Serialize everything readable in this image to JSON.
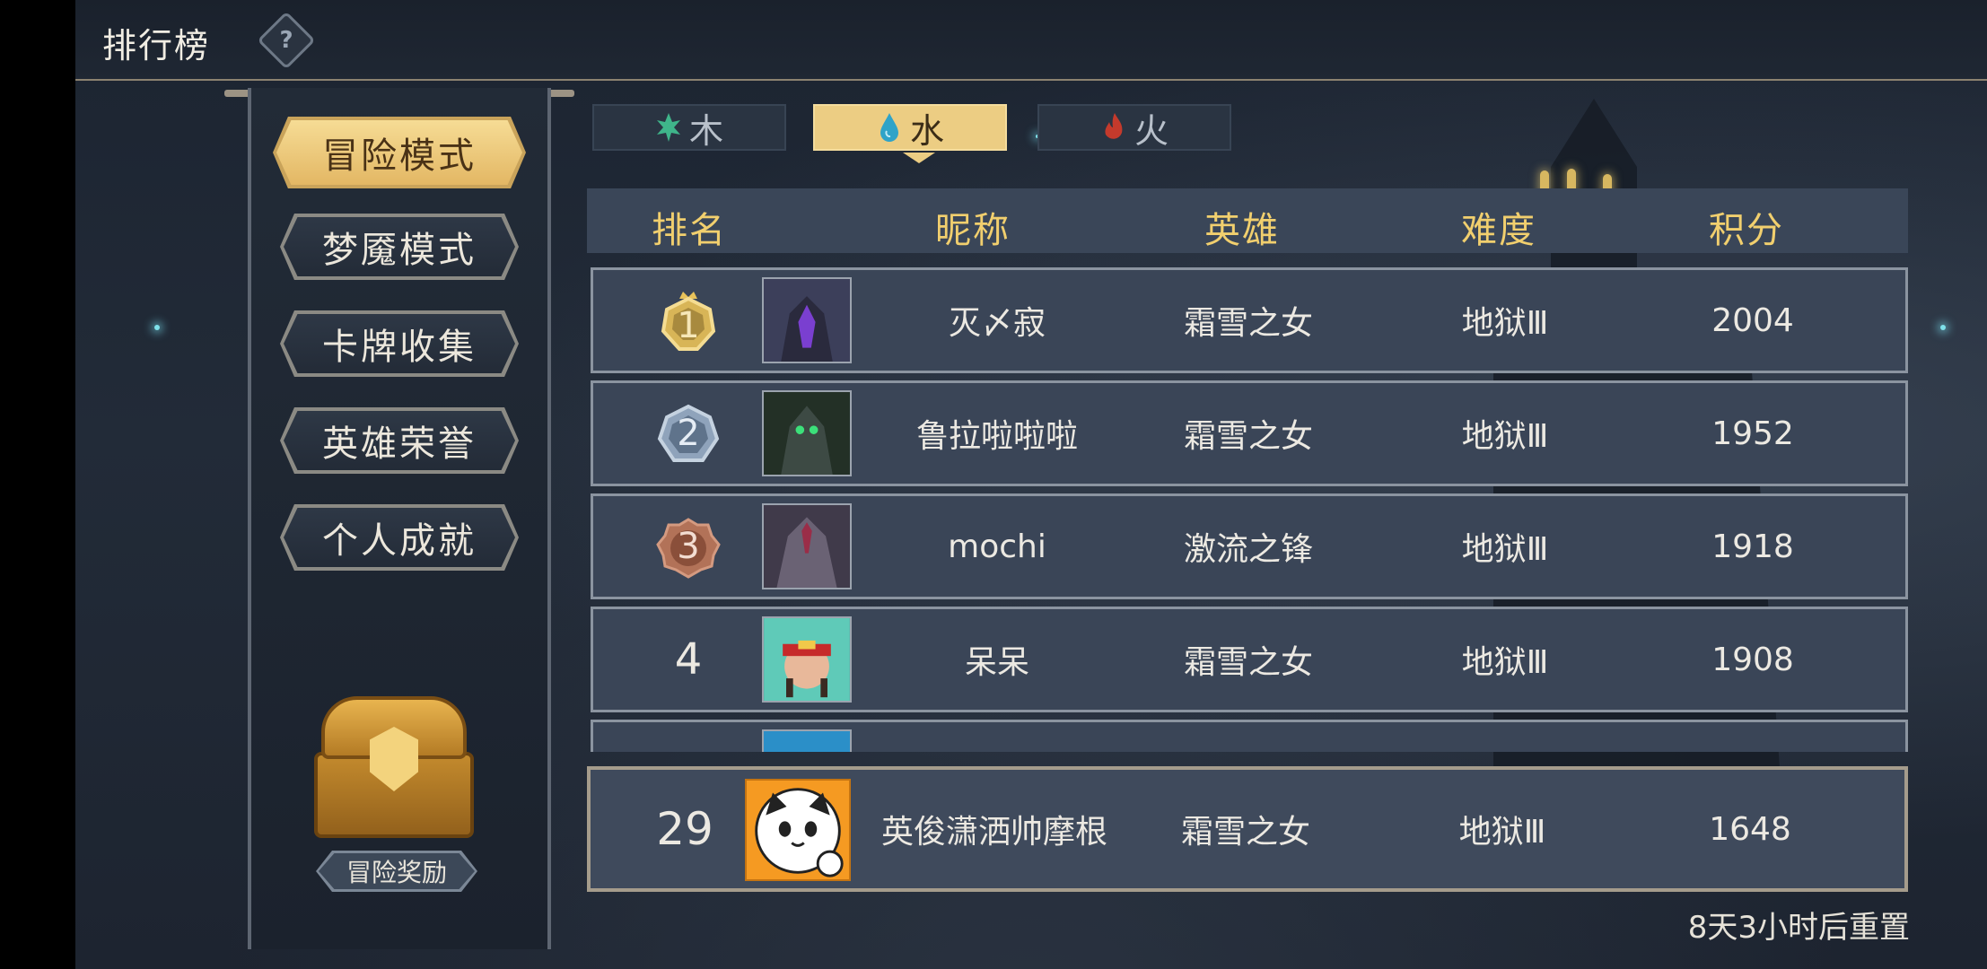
{
  "header": {
    "title": "排行榜",
    "help_icon": "question-gear-icon"
  },
  "side_menu": {
    "items": [
      {
        "label": "冒险模式",
        "active": true
      },
      {
        "label": "梦魇模式",
        "active": false
      },
      {
        "label": "卡牌收集",
        "active": false
      },
      {
        "label": "英雄荣誉",
        "active": false
      },
      {
        "label": "个人成就",
        "active": false
      }
    ],
    "reward_label": "冒险奖励",
    "reward_icon": "treasure-chest-icon"
  },
  "element_tabs": [
    {
      "label": "木",
      "icon": "leaf-icon",
      "color": "#3fb58a",
      "active": false
    },
    {
      "label": "水",
      "icon": "water-drop-icon",
      "color": "#2fa3c8",
      "active": true
    },
    {
      "label": "火",
      "icon": "flame-icon",
      "color": "#c43a2c",
      "active": false
    }
  ],
  "table": {
    "headers": {
      "rank": "排名",
      "nickname": "昵称",
      "hero": "英雄",
      "difficulty": "难度",
      "score": "积分"
    },
    "rows": [
      {
        "rank": "1",
        "nickname": "灭〆寂",
        "hero": "霜雪之女",
        "difficulty": "地狱Ⅲ",
        "score": "2004",
        "badge": "gold-crown"
      },
      {
        "rank": "2",
        "nickname": "鲁拉啦啦啦",
        "hero": "霜雪之女",
        "difficulty": "地狱Ⅲ",
        "score": "1952",
        "badge": "silver"
      },
      {
        "rank": "3",
        "nickname": "mochi",
        "hero": "激流之锋",
        "difficulty": "地狱Ⅲ",
        "score": "1918",
        "badge": "bronze"
      },
      {
        "rank": "4",
        "nickname": "呆呆",
        "hero": "霜雪之女",
        "difficulty": "地狱Ⅲ",
        "score": "1908",
        "badge": ""
      }
    ],
    "my_row": {
      "rank": "29",
      "nickname": "英俊潇洒帅摩根",
      "hero": "霜雪之女",
      "difficulty": "地狱Ⅲ",
      "score": "1648"
    }
  },
  "reset_text": "8天3小时后重置",
  "colors": {
    "accent_gold": "#f1cf6e",
    "panel": "#3a4557",
    "background": "#1f2733"
  }
}
